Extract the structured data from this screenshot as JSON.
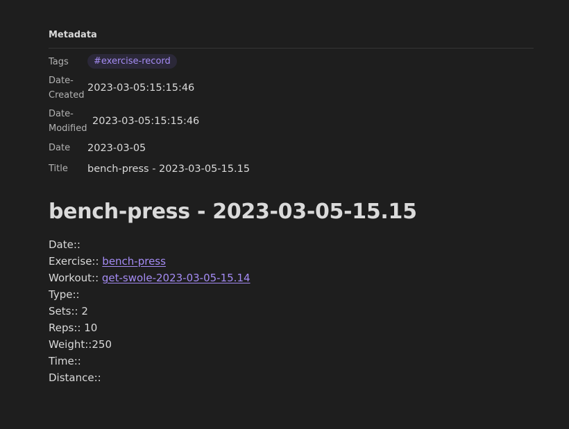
{
  "metadata": {
    "heading": "Metadata",
    "rows": [
      {
        "key": "Tags",
        "tag": "#exercise-record"
      },
      {
        "key_line1": "Date-",
        "key_line2": "Created",
        "value": "2023-03-05:15:15:46"
      },
      {
        "key_line1": "Date-",
        "key_line2": "Modified",
        "value": "2023-03-05:15:15:46"
      },
      {
        "key": "Date",
        "value": "2023-03-05"
      },
      {
        "key": "Title",
        "value": "bench-press - 2023-03-05-15.15"
      }
    ]
  },
  "note": {
    "title": "bench-press - 2023-03-05-15.15",
    "fields": [
      {
        "label": "Date::",
        "value": ""
      },
      {
        "label": "Exercise:: ",
        "link": "bench-press"
      },
      {
        "label": "Workout:: ",
        "link": "get-swole-2023-03-05-15.14"
      },
      {
        "label": "Type::",
        "value": ""
      },
      {
        "label": "Sets::",
        "value": " 2"
      },
      {
        "label": "Reps::",
        "value": " 10"
      },
      {
        "label": "Weight::",
        "value": "250"
      },
      {
        "label": "Time::",
        "value": ""
      },
      {
        "label": "Distance::",
        "value": ""
      }
    ]
  },
  "colors": {
    "background": "#1e1e1e",
    "text": "#dadada",
    "accent": "#a58cf5",
    "tag_background": "#2b2838"
  }
}
